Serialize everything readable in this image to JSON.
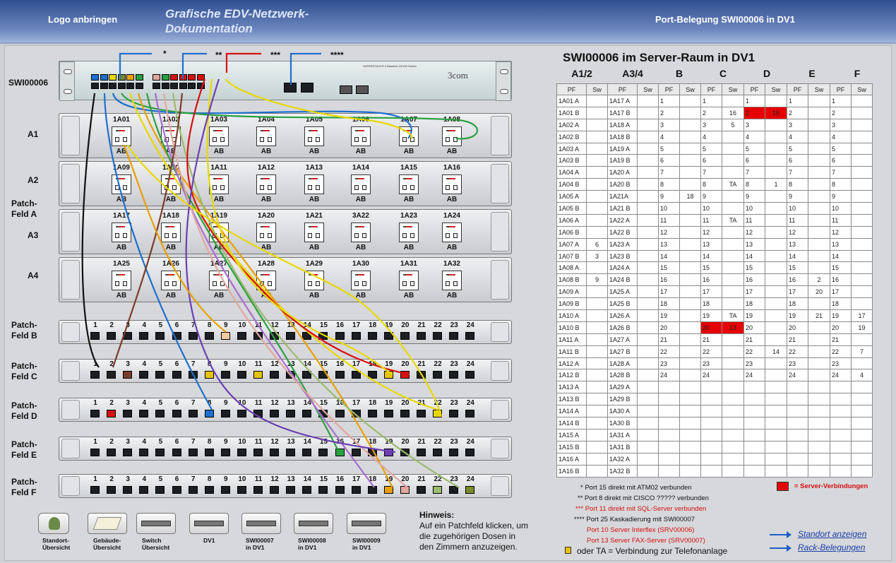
{
  "header": {
    "logo_text": "Logo anbringen",
    "app_title": "Grafische EDV-Netzwerk-Dokumentation",
    "port_title": "Port-Belegung SWI00006 in DV1"
  },
  "left": {
    "switch_label": "SWI00006",
    "switch_brand": "3com",
    "switch_tiny": "SUPERSTACK® II Baseline 10/100 Switch",
    "flow_markers": [
      "*",
      "**",
      "***",
      "****"
    ],
    "row_labels": [
      "A1",
      "A2",
      "Patch-\nFeld A",
      "A3",
      "A4",
      "Patch-\nFeld B",
      "Patch-\nFeld C",
      "Patch-\nFeld D",
      "Patch-\nFeld E",
      "Patch-\nFeld F"
    ],
    "panel_a_sockets": [
      [
        "1A01",
        "1A02",
        "1A03",
        "1A04",
        "1A05",
        "1A06",
        "1A07",
        "1A08"
      ],
      [
        "1A09",
        "1A10",
        "1A11",
        "1A12",
        "1A13",
        "1A14",
        "1A15",
        "1A16"
      ],
      [
        "1A17",
        "1A18",
        "1A19",
        "1A20",
        "1A21",
        "3A22",
        "1A23",
        "1A24"
      ],
      [
        "1A25",
        "1A26",
        "1A27",
        "1A28",
        "1A29",
        "1A30",
        "1A31",
        "1A32"
      ]
    ],
    "socket_sub": "AB",
    "patch_ports": [
      "1",
      "2",
      "3",
      "4",
      "5",
      "6",
      "7",
      "8",
      "9",
      "10",
      "11",
      "12",
      "13",
      "14",
      "15",
      "16",
      "17",
      "18",
      "19",
      "20",
      "21",
      "22",
      "23",
      "24"
    ]
  },
  "table": {
    "title": "SWI00006 im Server-Raum in DV1",
    "groups": [
      "A1/2",
      "A3/4",
      "B",
      "C",
      "D",
      "E",
      "F"
    ],
    "subhdr": [
      "PF",
      "Sw",
      "PF",
      "Sw",
      "PF",
      "Sw",
      "PF",
      "Sw",
      "PF",
      "Sw",
      "PF",
      "Sw",
      "PF",
      "Sw"
    ],
    "rows": [
      [
        "1A01 A",
        "",
        "1A17 A",
        "",
        "1",
        "",
        "1",
        "",
        "1",
        "",
        "1",
        "",
        "1",
        ""
      ],
      [
        "1A01 B",
        "",
        "1A17 B",
        "",
        "2",
        "",
        "2",
        "16",
        "2",
        "16",
        "2",
        "",
        "2",
        ""
      ],
      [
        "1A02 A",
        "",
        "1A18 A",
        "",
        "3",
        "",
        "3",
        "5",
        "3",
        "",
        "3",
        "",
        "3",
        ""
      ],
      [
        "1A02 B",
        "",
        "1A18 B",
        "",
        "4",
        "",
        "4",
        "",
        "4",
        "",
        "4",
        "",
        "4",
        ""
      ],
      [
        "1A03 A",
        "",
        "1A19 A",
        "",
        "5",
        "",
        "5",
        "",
        "5",
        "",
        "5",
        "",
        "5",
        ""
      ],
      [
        "1A03 B",
        "",
        "1A19 B",
        "",
        "6",
        "",
        "6",
        "",
        "6",
        "",
        "6",
        "",
        "6",
        ""
      ],
      [
        "1A04 A",
        "",
        "1A20 A",
        "",
        "7",
        "",
        "7",
        "",
        "7",
        "",
        "7",
        "",
        "7",
        ""
      ],
      [
        "1A04 B",
        "",
        "1A20 B",
        "",
        "8",
        "",
        "8",
        "TA",
        "8",
        "1",
        "8",
        "",
        "8",
        ""
      ],
      [
        "1A05 A",
        "",
        "1A21A",
        "",
        "9",
        "18",
        "9",
        "",
        "9",
        "",
        "9",
        "",
        "9",
        ""
      ],
      [
        "1A05 B",
        "",
        "1A21 B",
        "",
        "10",
        "",
        "10",
        "",
        "10",
        "",
        "10",
        "",
        "10",
        ""
      ],
      [
        "1A06 A",
        "",
        "1A22 A",
        "",
        "11",
        "",
        "11",
        "TA",
        "11",
        "",
        "11",
        "",
        "11",
        ""
      ],
      [
        "1A06 B",
        "",
        "1A22 B",
        "",
        "12",
        "",
        "12",
        "",
        "12",
        "",
        "12",
        "",
        "12",
        ""
      ],
      [
        "1A07 A",
        "6",
        "1A23 A",
        "",
        "13",
        "",
        "13",
        "",
        "13",
        "",
        "13",
        "",
        "13",
        ""
      ],
      [
        "1A07 B",
        "3",
        "1A23 B",
        "",
        "14",
        "",
        "14",
        "",
        "14",
        "",
        "14",
        "",
        "14",
        ""
      ],
      [
        "1A08 A",
        "",
        "1A24 A",
        "",
        "15",
        "",
        "15",
        "",
        "15",
        "",
        "15",
        "",
        "15",
        ""
      ],
      [
        "1A08 B",
        "9",
        "1A24 B",
        "",
        "16",
        "",
        "16",
        "",
        "16",
        "",
        "16",
        "2",
        "16",
        ""
      ],
      [
        "1A09 A",
        "",
        "1A25 A",
        "",
        "17",
        "",
        "17",
        "",
        "17",
        "",
        "17",
        "20",
        "17",
        ""
      ],
      [
        "1A09 B",
        "",
        "1A25 B",
        "",
        "18",
        "",
        "18",
        "",
        "18",
        "",
        "18",
        "",
        "18",
        ""
      ],
      [
        "1A10 A",
        "",
        "1A26 A",
        "",
        "19",
        "",
        "19",
        "TA",
        "19",
        "",
        "19",
        "21",
        "19",
        "17"
      ],
      [
        "1A10 B",
        "",
        "1A26 B",
        "",
        "20",
        "",
        "20",
        "13",
        "20",
        "",
        "20",
        "",
        "20",
        "19"
      ],
      [
        "1A11 A",
        "",
        "1A27 A",
        "",
        "21",
        "",
        "21",
        "",
        "21",
        "",
        "21",
        "",
        "21",
        ""
      ],
      [
        "1A11 B",
        "",
        "1A27 B",
        "",
        "22",
        "",
        "22",
        "",
        "22",
        "14",
        "22",
        "",
        "22",
        "7"
      ],
      [
        "1A12 A",
        "",
        "1A28 A",
        "",
        "23",
        "",
        "23",
        "",
        "23",
        "",
        "23",
        "",
        "23",
        ""
      ],
      [
        "1A12 B",
        "",
        "1A28 B",
        "",
        "24",
        "",
        "24",
        "",
        "24",
        "",
        "24",
        "",
        "24",
        "4"
      ],
      [
        "1A13 A",
        "",
        "1A29 A",
        "",
        "",
        "",
        "",
        "",
        "",
        "",
        "",
        "",
        "",
        ""
      ],
      [
        "1A13 B",
        "",
        "1A29 B",
        "",
        "",
        "",
        "",
        "",
        "",
        "",
        "",
        "",
        "",
        ""
      ],
      [
        "1A14 A",
        "",
        "1A30 A",
        "",
        "",
        "",
        "",
        "",
        "",
        "",
        "",
        "",
        "",
        ""
      ],
      [
        "1A14 B",
        "",
        "1A30 B",
        "",
        "",
        "",
        "",
        "",
        "",
        "",
        "",
        "",
        "",
        ""
      ],
      [
        "1A15 A",
        "",
        "1A31 A",
        "",
        "",
        "",
        "",
        "",
        "",
        "",
        "",
        "",
        "",
        ""
      ],
      [
        "1A15 B",
        "",
        "1A31 B",
        "",
        "",
        "",
        "",
        "",
        "",
        "",
        "",
        "",
        "",
        ""
      ],
      [
        "1A16 A",
        "",
        "1A32 A",
        "",
        "",
        "",
        "",
        "",
        "",
        "",
        "",
        "",
        "",
        ""
      ],
      [
        "1A16 B",
        "",
        "1A32 B",
        "",
        "",
        "",
        "",
        "",
        "",
        "",
        "",
        "",
        "",
        ""
      ]
    ],
    "red_cells": [
      [
        1,
        8
      ],
      [
        1,
        9
      ],
      [
        19,
        6
      ],
      [
        19,
        7
      ]
    ]
  },
  "notes": {
    "n1": "* Port 15 direkt mit ATM02 verbunden",
    "n2": "** Port 8 direkt mit CISCO ????? verbunden",
    "n3": "*** Port 11 direkt mit SQL-Server  verbunden",
    "n4": "**** Port 25 Kaskadierung mit SWI00007",
    "n5": "Port 10 Server Interflex (SRV00006)",
    "n6": "Port 13 Server FAX-Server (SRV00007)",
    "n7": "oder TA = Verbindung zur Telefonanlage",
    "legend": "= Server-Verbindungen"
  },
  "links": {
    "standort": "Standort anzeigen",
    "rack": "Rack-Belegungen"
  },
  "hint": {
    "title": "Hinweis:",
    "text1": "Auf ein Patchfeld klicken, um",
    "text2": "die zugehörigen Dosen in",
    "text3": "den Zimmern anzuzeigen."
  },
  "nav": [
    "Standort-\nÜbersicht",
    "Gebäude-\nÜbersicht",
    "Switch\nÜbersicht",
    "DV1",
    "SWI00007\nin DV1",
    "SWI00008\nin DV1",
    "SWI00009\nin DV1"
  ],
  "colors": {
    "red": "#e60000",
    "blue_link": "#1a3fa8",
    "header_top": "#2f4f8e"
  }
}
